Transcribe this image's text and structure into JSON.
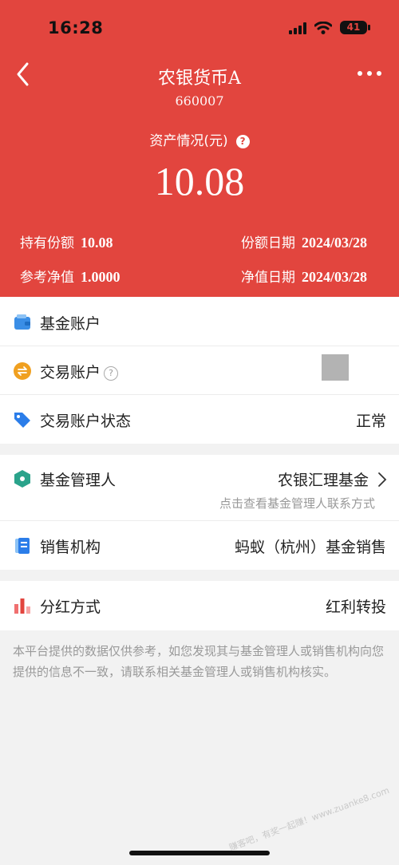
{
  "status_bar": {
    "time": "16:28",
    "battery": "41"
  },
  "header": {
    "fund_name": "农银货币A",
    "fund_code": "660007",
    "asset_label": "资产情况(元)",
    "asset_value": "10.08",
    "stats": {
      "shares_label": "持有份额",
      "shares_value": "10.08",
      "share_date_label": "份额日期",
      "share_date_value": "2024/03/28",
      "nav_label": "参考净值",
      "nav_value": "1.0000",
      "nav_date_label": "净值日期",
      "nav_date_value": "2024/03/28"
    }
  },
  "account_section": {
    "fund_account": "基金账户",
    "trade_account": "交易账户",
    "trade_status_label": "交易账户状态",
    "trade_status_value": "正常"
  },
  "org_section": {
    "manager_label": "基金管理人",
    "manager_value": "农银汇理基金",
    "manager_hint": "点击查看基金管理人联系方式",
    "seller_label": "销售机构",
    "seller_value": "蚂蚁（杭州）基金销售"
  },
  "dividend_section": {
    "label": "分红方式",
    "value": "红利转投"
  },
  "disclaimer": "本平台提供的数据仅供参考，如您发现其与基金管理人或销售机构向您提供的信息不一致，请联系相关基金管理人或销售机构核实。",
  "watermark": "赚客吧，有奖一起赚！www.zuanke8.com"
}
